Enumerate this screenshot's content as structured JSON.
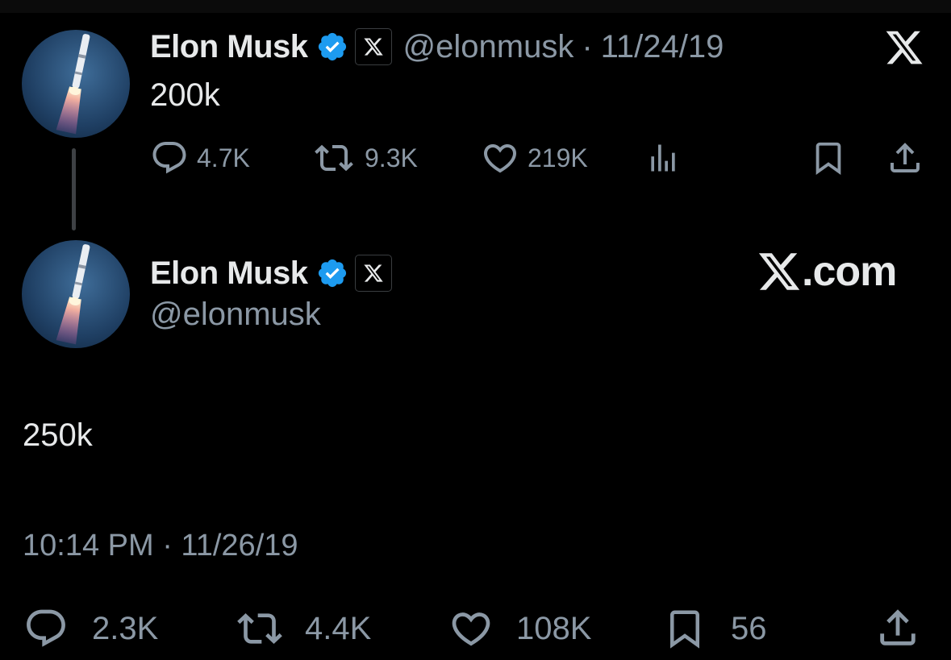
{
  "tweet1": {
    "author_name": "Elon Musk",
    "handle": "@elonmusk",
    "separator": "·",
    "date": "11/24/19",
    "text": "200k",
    "actions": {
      "replies": "4.7K",
      "retweets": "9.3K",
      "likes": "219K"
    }
  },
  "tweet2": {
    "author_name": "Elon Musk",
    "handle": "@elonmusk",
    "brand_text": ".com",
    "text": "250k",
    "timestamp": "10:14 PM · 11/26/19",
    "actions": {
      "replies": "2.3K",
      "retweets": "4.4K",
      "likes": "108K",
      "bookmarks": "56"
    }
  },
  "icons": {
    "verified": "verified-badge-icon",
    "affiliate": "x-affiliate-badge-icon",
    "logo": "x-logo-icon"
  },
  "colors": {
    "background": "#000000",
    "text_primary": "#e7e9ea",
    "text_secondary": "#8b98a5",
    "verified_blue": "#1d9bf0",
    "thread_line": "#3e4144"
  }
}
